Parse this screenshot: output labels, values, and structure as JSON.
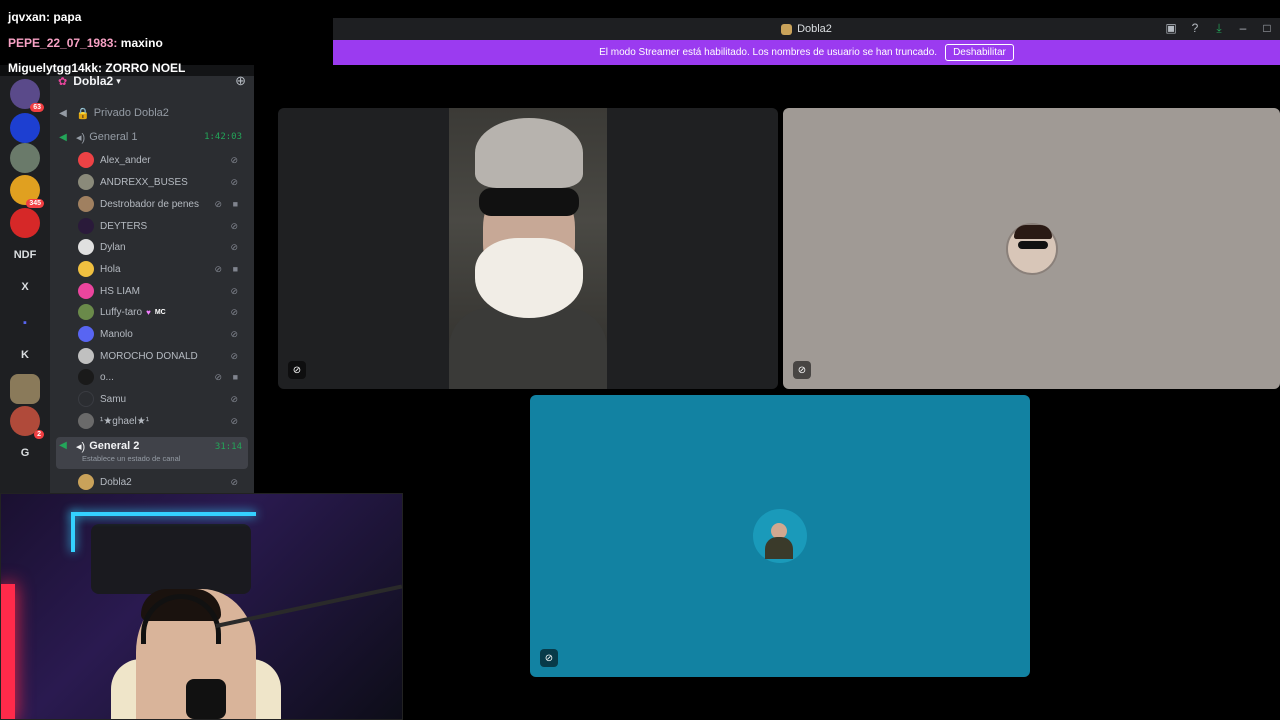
{
  "chat": [
    {
      "user": "jqvxan:",
      "message": "papa",
      "color": "#ffffff"
    },
    {
      "user": "PEPE_22_07_1983:",
      "message": "maxino",
      "color": "#f7a1c4"
    },
    {
      "user": "Miguelytgg14kk:",
      "message": "ZORRO NOEL",
      "color": "#ffffff"
    }
  ],
  "window": {
    "title": "Dobla2"
  },
  "banner": {
    "text": "El modo Streamer está habilitado. Los nombres de usuario se han truncado.",
    "button": "Deshabilitar"
  },
  "servers": [
    {
      "label": "",
      "badge": "63",
      "color": "#5a4a8a"
    },
    {
      "label": "",
      "badge": "",
      "color": "#1d3fd1"
    },
    {
      "label": "",
      "badge": "",
      "color": "#6a7a6a"
    },
    {
      "label": "",
      "badge": "345",
      "color": "#e0a020"
    },
    {
      "label": "",
      "badge": "",
      "color": "#d62828"
    },
    {
      "label": "NDF",
      "badge": "",
      "color": "transparent"
    },
    {
      "label": "X",
      "badge": "",
      "color": "transparent"
    },
    {
      "label": "▪",
      "badge": "",
      "color": "transparent"
    },
    {
      "label": "K",
      "badge": "",
      "color": "transparent"
    },
    {
      "label": "",
      "badge": "",
      "color": "#8a7a5a"
    },
    {
      "label": "",
      "badge": "2",
      "color": "#b04a3a"
    },
    {
      "label": "G",
      "badge": "",
      "color": "transparent"
    }
  ],
  "guild": {
    "name": "Dobla2"
  },
  "channels": {
    "private": "Privado Dobla2",
    "general1": {
      "name": "General 1",
      "timer": "1:42:03"
    },
    "general2": {
      "name": "General 2",
      "timer": "31:14",
      "status": "Establece un estado de canal"
    }
  },
  "voice_users_general1": [
    {
      "name": "Alex_ander",
      "avatar": "#ed4245",
      "cam": false
    },
    {
      "name": "ANDREXX_BUSES",
      "avatar": "#8a8a7a",
      "cam": false
    },
    {
      "name": "Destrobador de penes",
      "avatar": "#a08060",
      "cam": true
    },
    {
      "name": "DEYTERS",
      "avatar": "#2a1a3a",
      "cam": false
    },
    {
      "name": "Dylan",
      "avatar": "#e0e0e0",
      "cam": false
    },
    {
      "name": "Hola",
      "avatar": "#f0c040",
      "cam": true
    },
    {
      "name": "HS LIAM",
      "avatar": "#eb459e",
      "cam": false
    },
    {
      "name": "Luffy-taro",
      "avatar": "#6a8a4a",
      "cam": false,
      "tag": "MC"
    },
    {
      "name": "Manolo",
      "avatar": "#5865f2",
      "cam": false
    },
    {
      "name": "MOROCHO DONALD",
      "avatar": "#c0c0c0",
      "cam": false
    },
    {
      "name": "o...",
      "avatar": "#1a1a1a",
      "cam": true
    },
    {
      "name": "Samu",
      "avatar": "#2b2d31",
      "cam": false
    },
    {
      "name": "¹★ghael★¹",
      "avatar": "#6a6a6a",
      "cam": false
    }
  ],
  "voice_users_general2": [
    {
      "name": "Dobla2",
      "avatar": "#c9a25a",
      "cam": false
    }
  ],
  "colors": {
    "accent": "#9b3bf0",
    "speaking": "#23a559",
    "tile2": "#a09a95",
    "tile3": "#1282a2"
  }
}
